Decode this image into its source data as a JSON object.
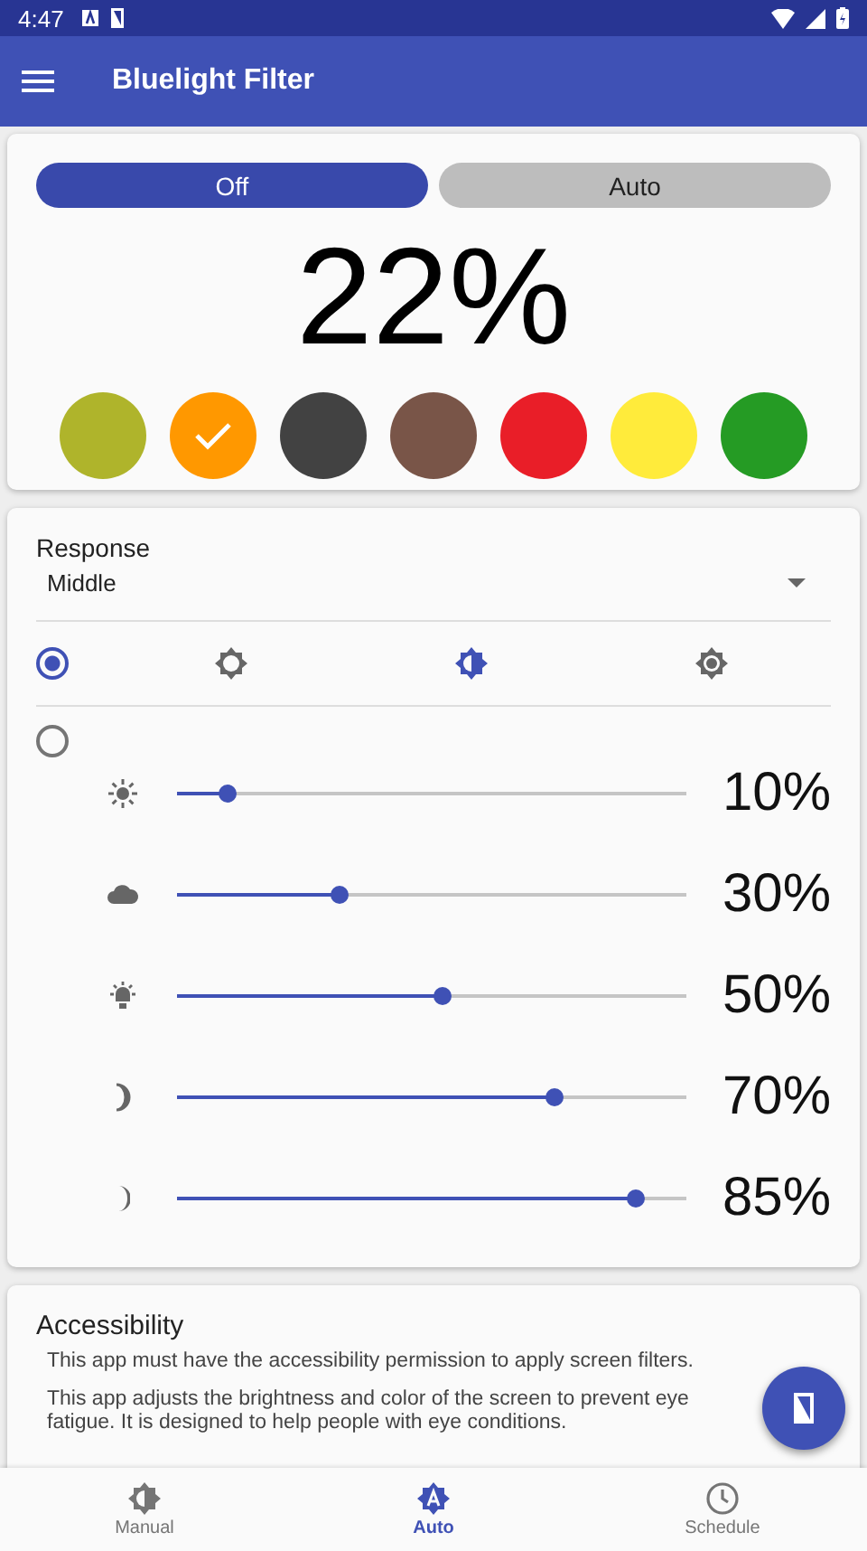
{
  "status_bar": {
    "time": "4:47"
  },
  "app_bar": {
    "title": "Bluelight Filter"
  },
  "mode_toggle": [
    {
      "label": "Off",
      "selected": true
    },
    {
      "label": "Auto",
      "selected": false
    }
  ],
  "filter_level": "22%",
  "swatches": [
    {
      "color": "#afb42b",
      "selected": false
    },
    {
      "color": "#ff9800",
      "selected": true
    },
    {
      "color": "#424242",
      "selected": false
    },
    {
      "color": "#795548",
      "selected": false
    },
    {
      "color": "#e91e28",
      "selected": false
    },
    {
      "color": "#ffeb3b",
      "selected": false
    },
    {
      "color": "#259b24",
      "selected": false
    }
  ],
  "response": {
    "label": "Response",
    "value": "Middle"
  },
  "brightness_mode": {
    "selected": true,
    "options": [
      {
        "kind": "low",
        "selected": false
      },
      {
        "kind": "half",
        "selected": true
      },
      {
        "kind": "high",
        "selected": false
      }
    ]
  },
  "custom_mode": {
    "selected": false
  },
  "light_levels": [
    {
      "kind": "sun",
      "level": 0.1,
      "reading": "10%"
    },
    {
      "kind": "cloud",
      "level": 0.32,
      "reading": "30%"
    },
    {
      "kind": "lamp",
      "level": 0.52,
      "reading": "50%"
    },
    {
      "kind": "moon",
      "level": 0.74,
      "reading": "70%"
    },
    {
      "kind": "crescent",
      "level": 0.9,
      "reading": "85%"
    }
  ],
  "accessibility": {
    "title": "Accessibility",
    "paragraphs": [
      "This app must have the accessibility permission to apply screen filters.",
      "This app adjusts the brightness and color of the screen to prevent eye fatigue. It is designed to help people with eye conditions."
    ]
  },
  "bottom_nav": [
    {
      "kind": "manual",
      "label": "Manual",
      "selected": false
    },
    {
      "kind": "auto",
      "label": "Auto",
      "selected": true
    },
    {
      "kind": "schedule",
      "label": "Schedule",
      "selected": false
    }
  ]
}
